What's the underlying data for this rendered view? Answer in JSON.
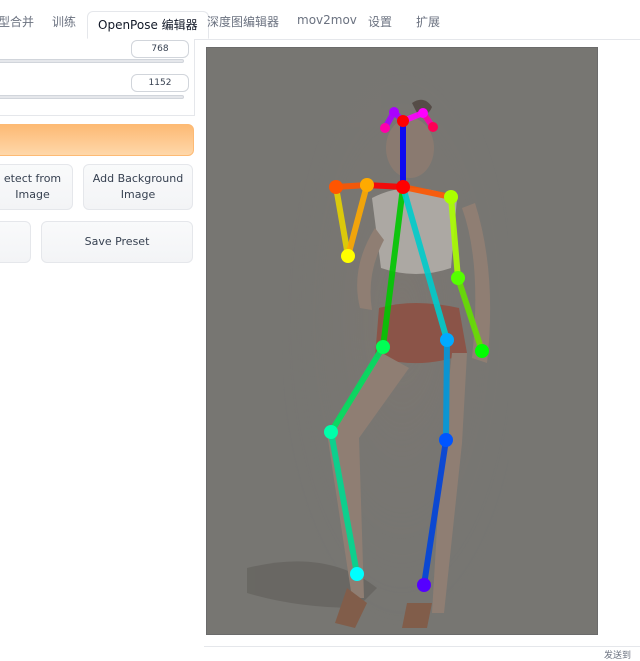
{
  "tabs": [
    {
      "label": "型合并",
      "active": false
    },
    {
      "label": "训练",
      "active": false
    },
    {
      "label": "OpenPose 编辑器",
      "active": true
    },
    {
      "label": "深度图编辑器",
      "active": false
    },
    {
      "label": "mov2mov",
      "active": false
    },
    {
      "label": "设置",
      "active": false
    },
    {
      "label": "扩展",
      "active": false
    }
  ],
  "controls": {
    "width_value": "768",
    "height_value": "1152"
  },
  "buttons": {
    "detect_label_1": "etect from",
    "detect_label_2": "Image",
    "add_bg_label_1": "Add Background",
    "add_bg_label_2": "Image",
    "save_preset": "Save Preset"
  },
  "footer": {
    "corner_text": "发送到"
  },
  "colors": {
    "accent": "#fdba74",
    "canvas_bg": "#777672"
  },
  "pose": {
    "keypoints": [
      {
        "name": "nose",
        "color": "#ff0000"
      },
      {
        "name": "neck",
        "color": "#ff0000"
      },
      {
        "name": "r-shoulder",
        "color": "#ff5500"
      },
      {
        "name": "r-elbow",
        "color": "#ffaa00"
      },
      {
        "name": "r-wrist",
        "color": "#ffff00"
      },
      {
        "name": "l-shoulder",
        "color": "#aaff00"
      },
      {
        "name": "l-elbow",
        "color": "#55ff00"
      },
      {
        "name": "l-wrist",
        "color": "#00ff00"
      },
      {
        "name": "r-hip",
        "color": "#00ff55"
      },
      {
        "name": "r-knee",
        "color": "#00ffaa"
      },
      {
        "name": "r-ankle",
        "color": "#00ffff"
      },
      {
        "name": "l-hip",
        "color": "#00aaff"
      },
      {
        "name": "l-knee",
        "color": "#0055ff"
      },
      {
        "name": "l-ankle",
        "color": "#5500ff"
      },
      {
        "name": "r-eye",
        "color": "#aa00ff"
      },
      {
        "name": "l-eye",
        "color": "#ff00ff"
      },
      {
        "name": "r-ear",
        "color": "#ff00aa"
      },
      {
        "name": "l-ear",
        "color": "#ff0055"
      }
    ]
  }
}
